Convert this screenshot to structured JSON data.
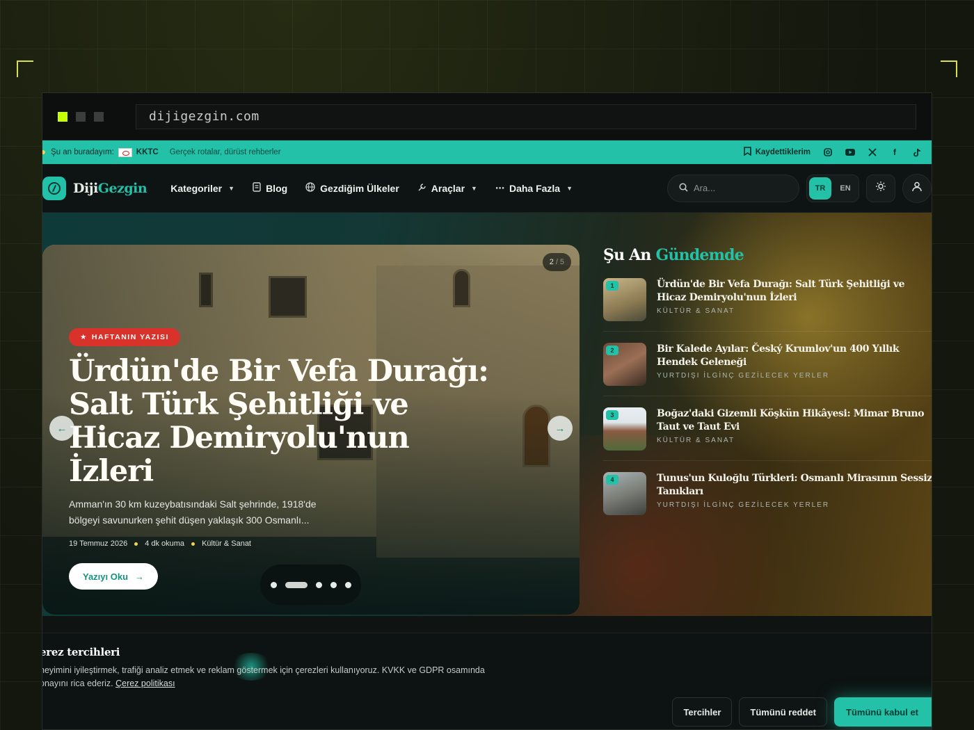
{
  "browser": {
    "url": "dijigezgin.com"
  },
  "topbar": {
    "location_label": "Şu an buradayım:",
    "location_value": "KKTC",
    "tagline": "Gerçek rotalar, dürüst rehberler",
    "saved_label": "Kaydettiklerim",
    "socials": [
      "instagram-icon",
      "youtube-icon",
      "x-icon",
      "facebook-icon",
      "tiktok-icon"
    ]
  },
  "nav": {
    "logo_a": "Diji",
    "logo_b": "Gezgin",
    "items": [
      {
        "label": "Kategoriler"
      },
      {
        "label": "Blog"
      },
      {
        "label": "Gezdiğim Ülkeler"
      },
      {
        "label": "Araçlar"
      },
      {
        "label": "Daha Fazla"
      }
    ],
    "search_placeholder": "Ara...",
    "lang_tr": "TR",
    "lang_en": "EN"
  },
  "hero": {
    "counter_current": "2",
    "counter_total": "5",
    "badge": "HAFTANIN YAZISI",
    "title": "Ürdün'de Bir Vefa Durağı: Salt Türk Şehitliği ve Hicaz Demiryolu'nun İzleri",
    "description": "Amman'ın 30 km kuzeybatısındaki Salt şehrinde, 1918'de bölgeyi savunurken şehit düşen yaklaşık 300 Osmanlı...",
    "date": "19 Temmuz 2026",
    "read_time": "4 dk okuma",
    "category": "Kültür & Sanat",
    "cta": "Yazıyı Oku"
  },
  "trending": {
    "title_a": "Şu An",
    "title_b": "Gündemde",
    "items": [
      {
        "num": "1",
        "title": "Ürdün'de Bir Vefa Durağı: Salt Türk Şehitliği ve Hicaz Demiryolu'nun İzleri",
        "category": "KÜLTÜR & SANAT"
      },
      {
        "num": "2",
        "title": "Bir Kalede Ayılar: Český Krumlov'un 400 Yıllık Hendek Geleneği",
        "category": "YURTDIŞI İLGİNÇ GEZİLECEK YERLER"
      },
      {
        "num": "3",
        "title": "Boğaz'daki Gizemli Köşkün Hikâyesi: Mimar Bruno Taut ve Taut Evi",
        "category": "KÜLTÜR & SANAT"
      },
      {
        "num": "4",
        "title": "Tunus'un Kuloğlu Türkleri: Osmanlı Mirasının Sessiz Tanıkları",
        "category": "YURTDIŞI İLGİNÇ GEZİLECEK YERLER"
      }
    ]
  },
  "cookie": {
    "title": "erez tercihleri",
    "text": "neyimini iyileştirmek, trafiği analiz etmek ve reklam göstermek için çerezleri kullanıyoruz. KVKK ve GDPR osamında onayını rica ederiz.",
    "link": "Çerez politikası",
    "prefs": "Tercihler",
    "reject": "Tümünü reddet",
    "accept": "Tümünü kabul et"
  },
  "colors": {
    "accent": "#22c1a8",
    "badge_red": "#d9322a",
    "lime": "#c6ff00"
  }
}
